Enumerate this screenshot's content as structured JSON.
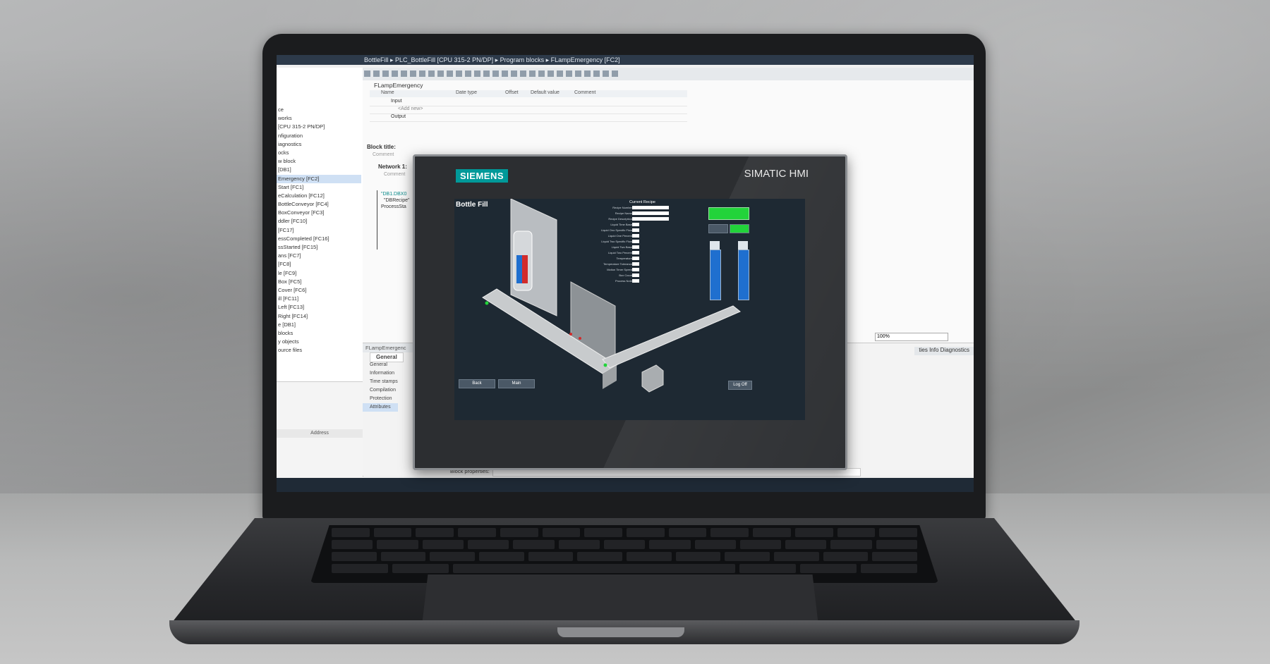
{
  "tia": {
    "breadcrumb": "BottleFill ▸ PLC_BottleFill [CPU 315-2 PN/DP] ▸ Program blocks ▸ FLampEmergency [FC2]",
    "tree_items": [
      "ce",
      "works",
      "[CPU 315-2 PN/DP]",
      "nfiguration",
      "iagnostics",
      "ocks",
      "w block",
      "[DB1]",
      "Emergency [FC2]",
      "Start [FC1]",
      "eCalculation [FC12]",
      "BottleConveyor [FC4]",
      "BoxConveyor [FC3]",
      "ddler [FC10]",
      "[FC17]",
      "essCompleted [FC16]",
      "ssStarted [FC15]",
      "ans [FC7]",
      "[FC8]",
      "le [FC9]",
      "Box [FC5]",
      "Cover [FC6]",
      "ill [FC11]",
      "Left [FC13]",
      "Right [FC14]",
      "e [DB1]",
      "blocks",
      "y objects",
      "ource files"
    ],
    "selected_index": 8,
    "address_header": "Address",
    "block_name": "FLampEmergency",
    "iface_headers": [
      "Name",
      "Date type",
      "Offset",
      "Default value",
      "Comment"
    ],
    "iface_rows": [
      "Input",
      "<Add new>",
      "Output"
    ],
    "block_title": "Block title:",
    "comment": "Comment",
    "network": "Network 1:",
    "network_comment": "Comment",
    "ladder_lines": [
      "\"DB1.DBX0",
      "\"DBRecipe\"",
      "ProcessSta"
    ],
    "lower_pane_title": "FLampEmergenc",
    "props_tab": "General",
    "props_items": [
      "General",
      "Information",
      "Time stamps",
      "Compilation",
      "Protection",
      "Attributes"
    ],
    "zoom": "100%",
    "info_tabs": "ties   Info   Diagnostics",
    "block_properties": "Block properties:"
  },
  "hmi": {
    "brand": "SIEMENS",
    "panel": "SIMATIC HMI",
    "screen_title": "Bottle Fill",
    "recipe_title": "Current Recipe",
    "recipe_labels": [
      "Recipe Number",
      "Recipe Name",
      "Recipe Description",
      "Liquid Time Base",
      "Liquid Ono Specific Flow",
      "Liquid One Percent",
      "Liquid Two Specific Flow",
      "Liquid Two Base",
      "Liquid Two Percent",
      "Temperature",
      "Temperature Tolerance",
      "Motion Timer Speed",
      "Box Count",
      "Process Note"
    ],
    "buttons": {
      "back": "Back",
      "main": "Main",
      "logoff": "Log Off"
    },
    "colors": {
      "green": "#22d33a",
      "brand": "#009999"
    }
  }
}
